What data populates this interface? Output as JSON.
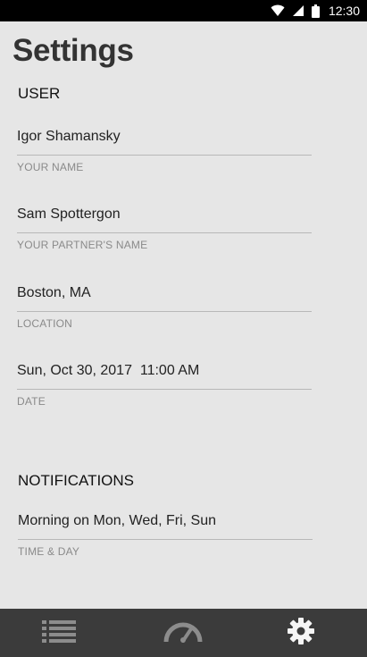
{
  "status_bar": {
    "time": "12:30",
    "icons": [
      "wifi-icon",
      "signal-icon",
      "battery-icon"
    ]
  },
  "page": {
    "title": "Settings"
  },
  "user_section": {
    "header": "USER",
    "fields": [
      {
        "value": "Igor Shamansky",
        "label": "YOUR NAME"
      },
      {
        "value": "Sam Spottergon",
        "label": "YOUR PARTNER'S NAME"
      },
      {
        "value": "Boston, MA",
        "label": "LOCATION"
      },
      {
        "value": "Sun, Oct 30, 2017  11:00 AM",
        "label": "DATE"
      }
    ]
  },
  "notifications_section": {
    "header": "NOTIFICATIONS",
    "fields": [
      {
        "value": "Morning on Mon, Wed, Fri, Sun",
        "label": "TIME & DAY"
      }
    ]
  },
  "bottom_nav": {
    "items": [
      {
        "icon": "list-icon",
        "active": false
      },
      {
        "icon": "speedometer-icon",
        "active": false
      },
      {
        "icon": "gear-icon",
        "active": true
      }
    ],
    "colors": {
      "background": "#3b3b3b",
      "inactive": "#8c8c8c",
      "active": "#f5f5f5"
    }
  }
}
